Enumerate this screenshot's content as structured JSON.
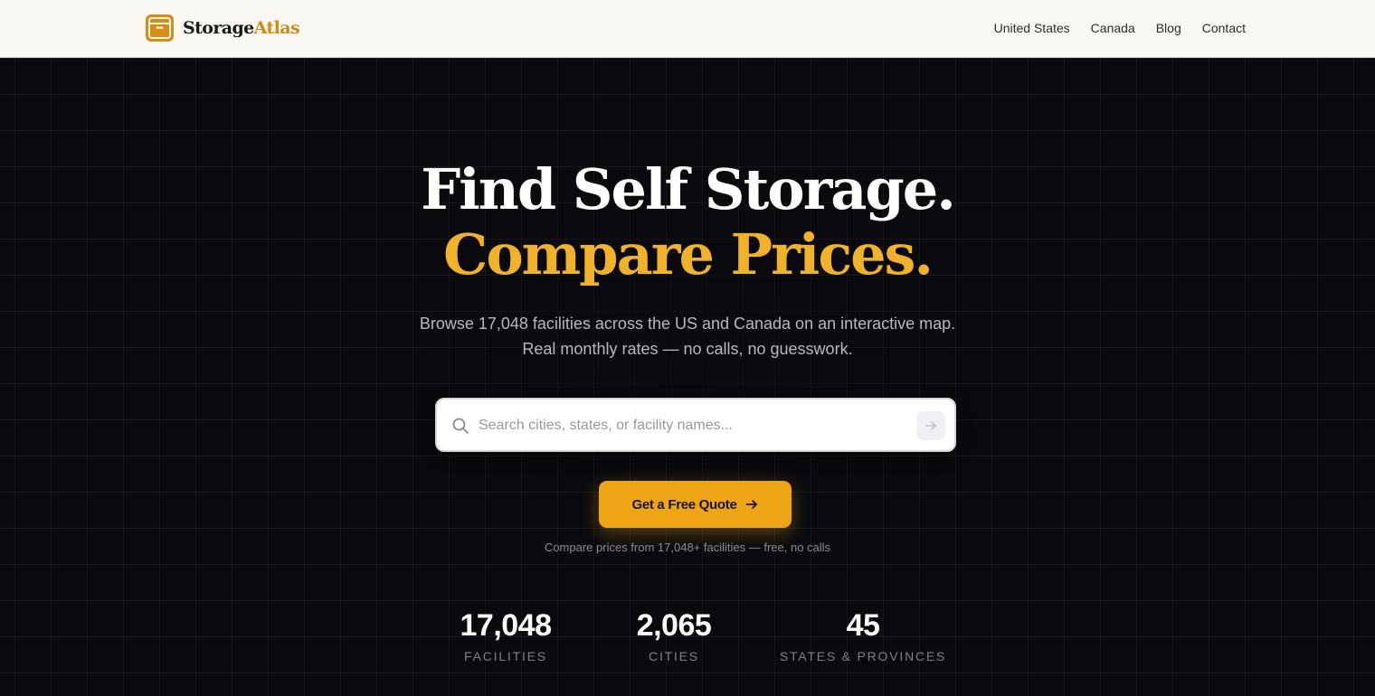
{
  "header": {
    "brand_part1": "Storage",
    "brand_part2": "Atlas",
    "nav": [
      "United States",
      "Canada",
      "Blog",
      "Contact"
    ]
  },
  "hero": {
    "headline_line1": "Find Self Storage.",
    "headline_line2": "Compare Prices.",
    "subtitle_line1": "Browse 17,048 facilities across the US and Canada on an interactive map.",
    "subtitle_line2": "Real monthly rates — no calls, no guesswork.",
    "search_placeholder": "Search cities, states, or facility names...",
    "cta_label": "Get a Free Quote",
    "cta_note": "Compare prices from 17,048+ facilities — free, no calls"
  },
  "stats": [
    {
      "value": "17,048",
      "label": "FACILITIES"
    },
    {
      "value": "2,065",
      "label": "CITIES"
    },
    {
      "value": "45",
      "label": "STATES & PROVINCES"
    }
  ],
  "colors": {
    "accent": "#eda515",
    "headline_accent": "#f0b22a",
    "brand_accent": "#cf8a17",
    "hero_bg": "#0a0a0e",
    "header_bg": "#f9f8f3"
  },
  "icons": {
    "logo": "storage-box-icon",
    "search": "search-icon",
    "search_submit": "arrow-right-icon",
    "cta": "arrow-right-icon"
  }
}
